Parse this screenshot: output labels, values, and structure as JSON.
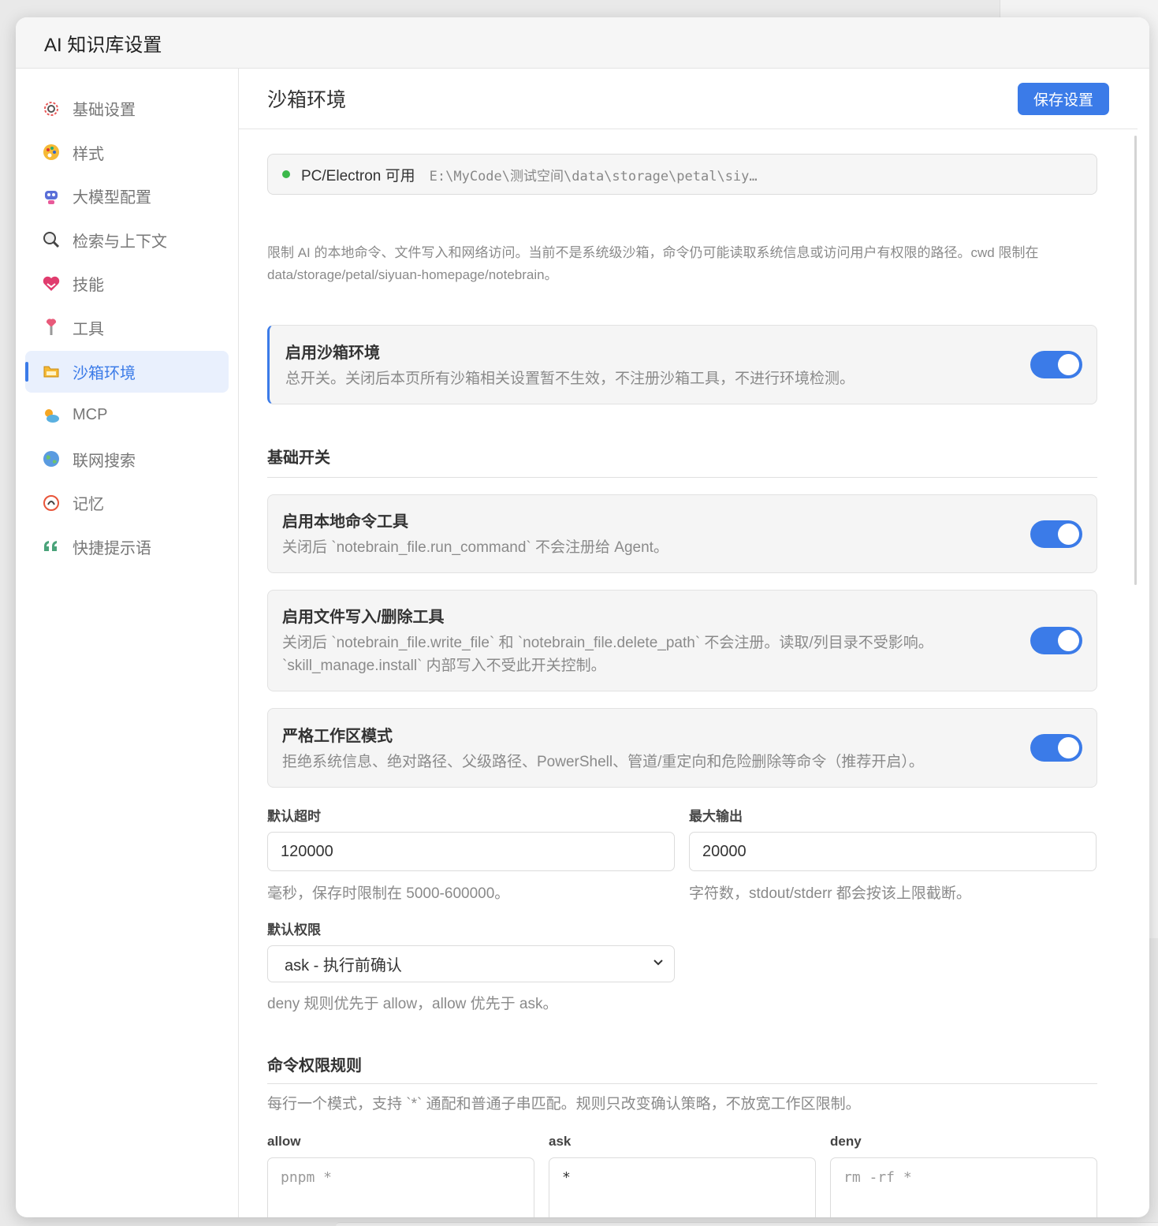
{
  "dialog": {
    "title": "AI 知识库设置"
  },
  "sidebar": {
    "items": [
      {
        "label": "基础设置",
        "icon": "gear-icon"
      },
      {
        "label": "样式",
        "icon": "palette-icon"
      },
      {
        "label": "大模型配置",
        "icon": "robot-icon"
      },
      {
        "label": "检索与上下文",
        "icon": "magnifier-icon"
      },
      {
        "label": "技能",
        "icon": "heart-hands-icon"
      },
      {
        "label": "工具",
        "icon": "pin-tool-icon"
      },
      {
        "label": "沙箱环境",
        "icon": "folder-icon",
        "active": true
      },
      {
        "label": "MCP",
        "icon": "cloud-sun-icon"
      },
      {
        "label": "联网搜索",
        "icon": "globe-icon"
      },
      {
        "label": "记忆",
        "icon": "memory-icon"
      },
      {
        "label": "快捷提示语",
        "icon": "quote-icon"
      }
    ]
  },
  "main": {
    "title": "沙箱环境",
    "save_label": "保存设置",
    "status": {
      "label": "PC/Electron 可用",
      "path": "E:\\MyCode\\测试空间\\data\\storage\\petal\\siy…",
      "color": "#3bb84a"
    },
    "intro": "限制 AI 的本地命令、文件写入和网络访问。当前不是系统级沙箱，命令仍可能读取系统信息或访问用户有权限的路径。cwd 限制在 data/storage/petal/siyuan-homepage/notebrain。",
    "master": {
      "title": "启用沙箱环境",
      "desc": "总开关。关闭后本页所有沙箱相关设置暂不生效，不注册沙箱工具，不进行环境检测。",
      "enabled": true
    },
    "basic_section": "基础开关",
    "toggles": [
      {
        "title": "启用本地命令工具",
        "desc": "关闭后 `notebrain_file.run_command` 不会注册给 Agent。",
        "enabled": true
      },
      {
        "title": "启用文件写入/删除工具",
        "desc": "关闭后 `notebrain_file.write_file` 和 `notebrain_file.delete_path` 不会注册。读取/列目录不受影响。`skill_manage.install` 内部写入不受此开关控制。",
        "enabled": true
      },
      {
        "title": "严格工作区模式",
        "desc": "拒绝系统信息、绝对路径、父级路径、PowerShell、管道/重定向和危险删除等命令（推荐开启）。",
        "enabled": true
      }
    ],
    "timeout": {
      "label": "默认超时",
      "value": "120000",
      "hint": "毫秒，保存时限制在 5000-600000。"
    },
    "max_output": {
      "label": "最大输出",
      "value": "20000",
      "hint": "字符数，stdout/stderr 都会按该上限截断。"
    },
    "permission": {
      "label": "默认权限",
      "value": "ask - 执行前确认",
      "hint": "deny 规则优先于 allow，allow 优先于 ask。"
    },
    "rules": {
      "title": "命令权限规则",
      "desc": "每行一个模式，支持 `*` 通配和普通子串匹配。规则只改变确认策略，不放宽工作区限制。",
      "allow": {
        "label": "allow",
        "placeholder": "pnpm *",
        "value": ""
      },
      "ask": {
        "label": "ask",
        "placeholder": "",
        "value": "*"
      },
      "deny": {
        "label": "deny",
        "placeholder": "rm -rf *",
        "value": ""
      }
    }
  },
  "theme": {
    "accent": "#3b7be8"
  }
}
